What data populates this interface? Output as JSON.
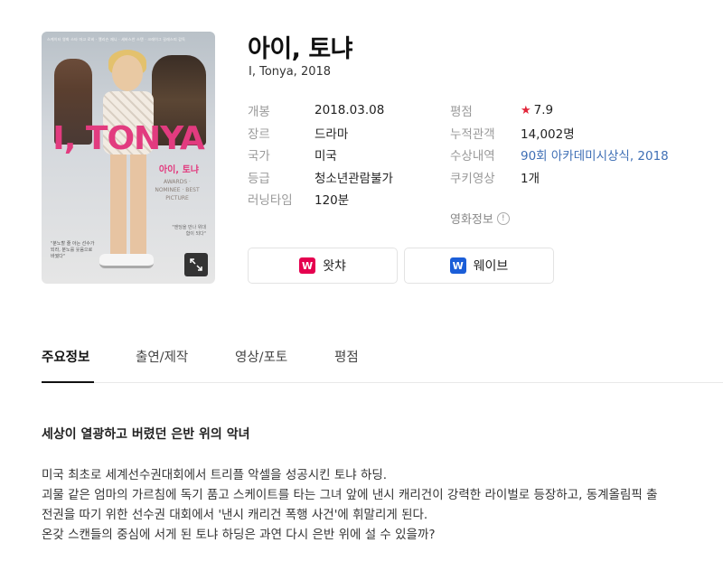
{
  "movie": {
    "title": "아이, 토냐",
    "subtitle": "I, Tonya, 2018"
  },
  "poster": {
    "credits": "스케이터 영화 스타 마고 로비 · 앨리슨 재니 · 세바스찬 스탠 · 크레이그 길레스피 감독",
    "title": "I, TONYA",
    "subtitle": "아이, 토냐",
    "laurels": "AWARDS · NOMINEE · BEST PICTURE",
    "quote": "\"분노할 줄 아는 선수가 되라, 분노를 웃음으로 바꿨다\"",
    "quote2": "\"엔딩을 만나 위대함이 되다\""
  },
  "info_left": [
    {
      "key": "개봉",
      "value": "2018.03.08"
    },
    {
      "key": "장르",
      "value": "드라마"
    },
    {
      "key": "국가",
      "value": "미국"
    },
    {
      "key": "등급",
      "value": "청소년관람불가"
    },
    {
      "key": "러닝타임",
      "value": "120분"
    }
  ],
  "info_right": [
    {
      "key": "평점",
      "value": "7.9",
      "star": "★"
    },
    {
      "key": "누적관객",
      "value": "14,002명"
    },
    {
      "key": "수상내역",
      "value": "90회 아카데미시상식, 2018"
    },
    {
      "key": "쿠키영상",
      "value": "1개"
    }
  ],
  "movie_info_label": "영화정보",
  "movie_info_icon": "!",
  "ott": [
    {
      "label": "왓챠",
      "logo_text": "W",
      "color": "#e5004f"
    },
    {
      "label": "웨이브",
      "logo_text": "W",
      "color": "#1b5ed8"
    }
  ],
  "tabs": [
    {
      "label": "주요정보",
      "active": true
    },
    {
      "label": "출연/제작",
      "active": false
    },
    {
      "label": "영상/포토",
      "active": false
    },
    {
      "label": "평점",
      "active": false
    }
  ],
  "synopsis": {
    "title": "세상이 열광하고 버렸던 은반 위의 악녀",
    "lines": [
      "미국 최초로 세계선수권대회에서 트리플 악셀을 성공시킨 토냐 하딩.",
      "괴물 같은 엄마의 가르침에 독기 품고 스케이트를 타는 그녀 앞에 낸시 캐리건이 강력한 라이벌로 등장하고, 동계올림픽 출",
      "전권을 따기 위한 선수권 대회에서 '낸시 캐리건 폭행 사건'에 휘말리게 된다.",
      "온갖 스캔들의 중심에 서게 된 토냐 하딩은 과연 다시 은반 위에 설 수 있을까?"
    ]
  },
  "colors": {
    "accent_star": "#e2263a",
    "link": "#3f6fb5",
    "poster_title": "#e23b7f"
  }
}
